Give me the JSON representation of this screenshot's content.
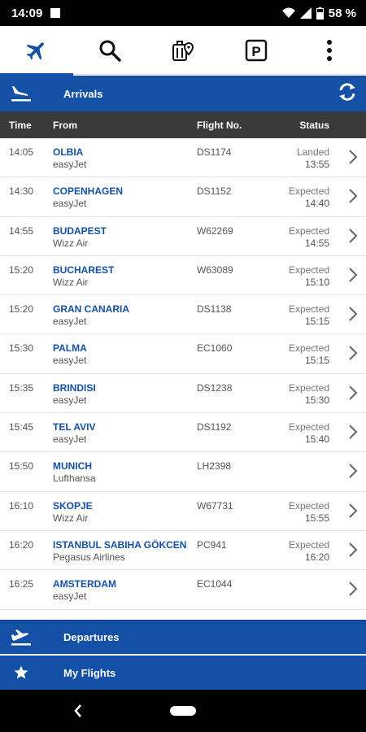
{
  "status_bar": {
    "time": "14:09",
    "battery": "58 %",
    "icons": [
      "photo-icon",
      "wifi-icon",
      "signal-icon",
      "battery-icon"
    ]
  },
  "tabs": [
    {
      "name": "flights",
      "icon": "airplane-icon",
      "active": true
    },
    {
      "name": "search",
      "icon": "search-icon",
      "active": false
    },
    {
      "name": "baggage",
      "icon": "luggage-location-icon",
      "active": false
    },
    {
      "name": "parking",
      "icon": "parking-icon",
      "active": false
    },
    {
      "name": "more",
      "icon": "more-vert-icon",
      "active": false
    }
  ],
  "header": {
    "title": "Arrivals"
  },
  "columns": {
    "time": "Time",
    "from": "From",
    "flight": "Flight No.",
    "status": "Status"
  },
  "flights": [
    {
      "time": "14:05",
      "city": "OLBIA",
      "airline": "easyJet",
      "flight": "DS1174",
      "status": "Landed",
      "status_time": "13:55"
    },
    {
      "time": "14:30",
      "city": "COPENHAGEN",
      "airline": "easyJet",
      "flight": "DS1152",
      "status": "Expected",
      "status_time": "14:40"
    },
    {
      "time": "14:55",
      "city": "BUDAPEST",
      "airline": "Wizz Air",
      "flight": "W62269",
      "status": "Expected",
      "status_time": "14:55"
    },
    {
      "time": "15:20",
      "city": "BUCHAREST",
      "airline": "Wizz Air",
      "flight": "W63089",
      "status": "Expected",
      "status_time": "15:10"
    },
    {
      "time": "15:20",
      "city": "GRAN CANARIA",
      "airline": "easyJet",
      "flight": "DS1138",
      "status": "Expected",
      "status_time": "15:15"
    },
    {
      "time": "15:30",
      "city": "PALMA",
      "airline": "easyJet",
      "flight": "EC1060",
      "status": "Expected",
      "status_time": "15:15"
    },
    {
      "time": "15:35",
      "city": "BRINDISI",
      "airline": "easyJet",
      "flight": "DS1238",
      "status": "Expected",
      "status_time": "15:30"
    },
    {
      "time": "15:45",
      "city": "TEL AVIV",
      "airline": "easyJet",
      "flight": "DS1192",
      "status": "Expected",
      "status_time": "15:40"
    },
    {
      "time": "15:50",
      "city": "MUNICH",
      "airline": "Lufthansa",
      "flight": "LH2398",
      "status": "",
      "status_time": ""
    },
    {
      "time": "16:10",
      "city": "SKOPJE",
      "airline": "Wizz Air",
      "flight": "W67731",
      "status": "Expected",
      "status_time": "15:55"
    },
    {
      "time": "16:20",
      "city": "ISTANBUL SABIHA GÖKCEN",
      "airline": "Pegasus Airlines",
      "flight": "PC941",
      "status": "Expected",
      "status_time": "16:20"
    },
    {
      "time": "16:25",
      "city": "AMSTERDAM",
      "airline": "easyJet",
      "flight": "EC1044",
      "status": "",
      "status_time": ""
    }
  ],
  "bottom": {
    "departures": "Departures",
    "my_flights": "My Flights"
  },
  "colors": {
    "brand_blue": "#1450a6",
    "header_dark": "#3a3a3a"
  }
}
